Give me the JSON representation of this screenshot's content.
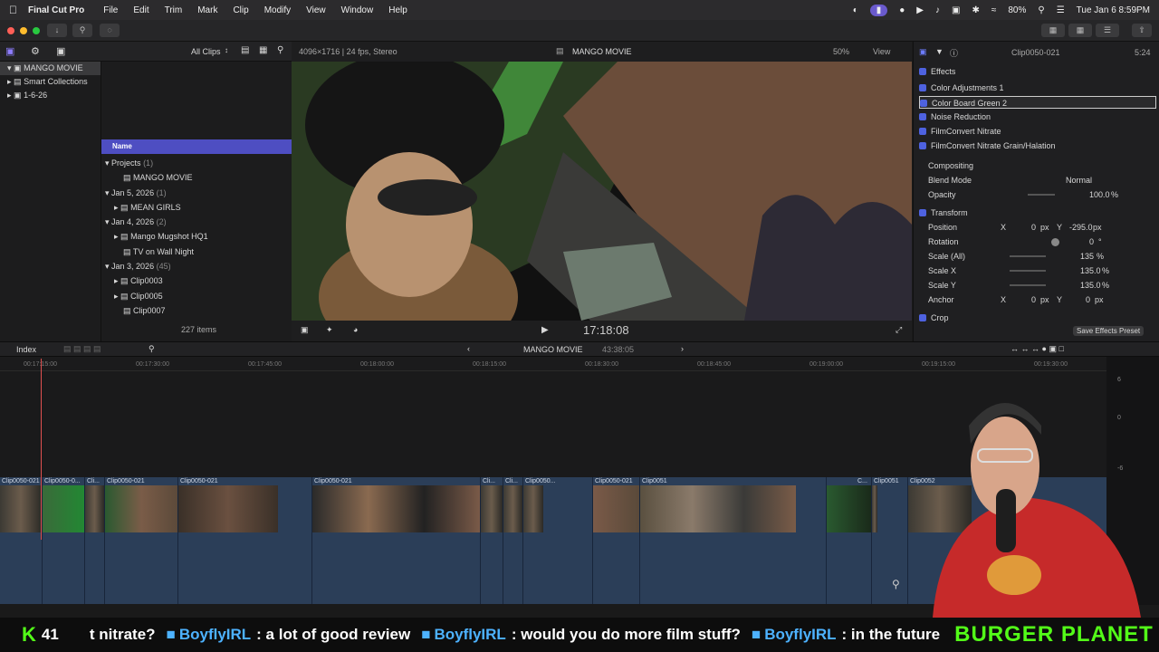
{
  "menubar": {
    "app": "Final Cut Pro",
    "items": [
      "File",
      "Edit",
      "Trim",
      "Mark",
      "Clip",
      "Modify",
      "View",
      "Window",
      "Help"
    ],
    "battery": "80%",
    "clock": "Tue Jan 6  8:59PM"
  },
  "browser": {
    "filter": "All Clips",
    "library": "MANGO MOVIE",
    "library_items": [
      "Smart Collections",
      "1-6-26"
    ],
    "column_header": "Name",
    "groups": [
      {
        "label": "Projects",
        "count": "(1)",
        "items": [
          "MANGO MOVIE"
        ]
      },
      {
        "label": "Jan 5, 2026",
        "count": "(1)",
        "items": [
          "MEAN GIRLS"
        ]
      },
      {
        "label": "Jan 4, 2026",
        "count": "(2)",
        "items": [
          "Mango Mugshot HQ1",
          "TV on Wall Night"
        ]
      },
      {
        "label": "Jan 3, 2026",
        "count": "(45)",
        "items": [
          "Clip0003",
          "Clip0005",
          "Clip0007"
        ]
      }
    ],
    "item_count": "227 items"
  },
  "viewer": {
    "format": "4096×1716 | 24 fps, Stereo",
    "title": "MANGO MOVIE",
    "zoom": "50%",
    "view_menu": "View",
    "timecode": "17:18:08"
  },
  "inspector": {
    "clip_name": "Clip0050-021",
    "duration": "5:24",
    "effects_header": "Effects",
    "effects": [
      "Color Adjustments 1",
      "Color Board Green 2",
      "Noise Reduction",
      "FilmConvert Nitrate",
      "FilmConvert Nitrate Grain/Halation"
    ],
    "compositing_header": "Compositing",
    "blend_mode_label": "Blend Mode",
    "blend_mode_value": "Normal",
    "opacity_label": "Opacity",
    "opacity_value": "100.0",
    "transform_header": "Transform",
    "position_label": "Position",
    "position_x": "0",
    "position_y": "-295.0",
    "rotation_label": "Rotation",
    "rotation_value": "0",
    "scale_all_label": "Scale (All)",
    "scale_all_value": "135",
    "scale_x_label": "Scale X",
    "scale_x_value": "135.0",
    "scale_y_label": "Scale Y",
    "scale_y_value": "135.0",
    "anchor_label": "Anchor",
    "anchor_x": "0",
    "anchor_y": "0",
    "crop_header": "Crop",
    "save_preset": "Save Effects Preset",
    "unit_px": "px",
    "unit_pct": "%",
    "unit_deg": "°",
    "axis_x": "X",
    "axis_y": "Y"
  },
  "timeline": {
    "index_label": "Index",
    "project": "MANGO MOVIE",
    "duration": "43:38:05",
    "ruler": [
      "00:17:15:00",
      "00:17:30:00",
      "00:17:45:00",
      "00:18:00:00",
      "00:18:15:00",
      "00:18:30:00",
      "00:18:45:00",
      "00:19:00:00",
      "00:19:15:00",
      "00:19:30:00"
    ],
    "clips": [
      "Clip0050-021",
      "Clip0050-0...",
      "Cli...",
      "Clip0050-021",
      "Clip0050-021",
      "Clip0050-021",
      "Cli...",
      "Cli...",
      "Clip0050...",
      "Clip0050-021",
      "Clip0051",
      "C...",
      "Clip0051",
      "Clip0052"
    ],
    "meter_marks": [
      "6",
      "0",
      "-6"
    ]
  },
  "ticker": {
    "count": "41",
    "messages": [
      {
        "user": "",
        "text": "t nitrate?"
      },
      {
        "user": "BoyflyIRL",
        "text": ": a lot of good review"
      },
      {
        "user": "BoyflyIRL",
        "text": ": would you do more film stuff?"
      },
      {
        "user": "BoyflyIRL",
        "text": ": in the future"
      }
    ],
    "brand": "BURGER PLANET"
  }
}
